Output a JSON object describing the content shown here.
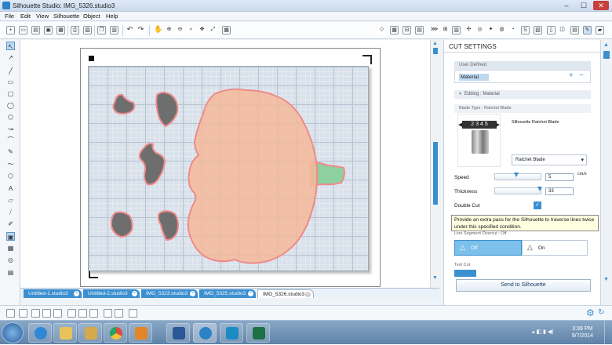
{
  "window": {
    "title": "Silhouette Studio: IMG_5326.studio3",
    "min": "–",
    "max": "☐",
    "close": "✕"
  },
  "menu": [
    "File",
    "Edit",
    "View",
    "Silhouette",
    "Object",
    "Help"
  ],
  "doc_tabs": [
    {
      "label": "Untitled-1.studio3",
      "active": false
    },
    {
      "label": "Untitled-2.studio3",
      "active": false
    },
    {
      "label": "IMG_5323.studio3",
      "active": false
    },
    {
      "label": "IMG_5325.studio3",
      "active": false
    },
    {
      "label": "IMG_5326.studio3",
      "active": true
    }
  ],
  "cut_settings": {
    "panel_title": "CUT SETTINGS",
    "user_defined": "User Defined",
    "material_row": "Material",
    "editing_header": "Editing : Material",
    "blade_type_label": "Blade Type : Ratchet Blade",
    "blade_name": "Silhouette Ratchet Blade",
    "blade_select": "Ratchet Blade",
    "blade_numbers": [
      "2",
      "3",
      "4",
      "5"
    ],
    "speed_label": "Speed",
    "speed_value": "5",
    "speed_unit": "cm/s",
    "thickness_label": "Thickness",
    "thickness_value": "33",
    "double_cut_label": "Double Cut",
    "double_cut_checked": true,
    "tooltip": "Provide an extra pass for the Silhouette to traverse lines twice under this specified condition.",
    "overcut_label": "Line Segment Overcut : Off",
    "off_label": "Off",
    "on_label": "On",
    "test_cut_label": "Test Cut",
    "send_button": "Send to Silhouette"
  },
  "clock": {
    "time": "3:39 PM",
    "date": "9/7/2014"
  },
  "colors": {
    "accent": "#3a8fd0",
    "shape_fill": "#f4b89a",
    "shape_stroke": "#f08a8a",
    "dark_fill": "#6e6e6e",
    "stem": "#8fd0a0",
    "taskbar": "#6f92b8"
  }
}
